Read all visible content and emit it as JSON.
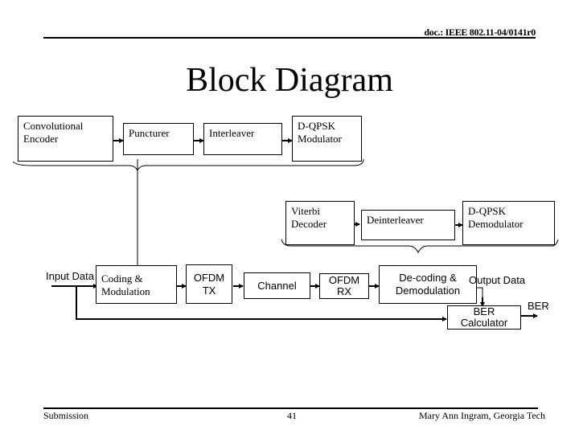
{
  "header": {
    "doc_id": "doc.: IEEE 802.11-04/0141r0",
    "title": "Block Diagram"
  },
  "encoder_chain": {
    "blocks": [
      {
        "label": "Convolutional Encoder"
      },
      {
        "label": "Puncturer"
      },
      {
        "label": "Interleaver"
      },
      {
        "label": "D-QPSK Modulator"
      }
    ]
  },
  "decoder_chain": {
    "blocks": [
      {
        "label": "Viterbi Decoder"
      },
      {
        "label": "Deinterleaver"
      },
      {
        "label": "D-QPSK Demodulator"
      }
    ]
  },
  "system_chain": {
    "input_label": "Input Data",
    "output_label": "Output Data",
    "ber_label": "BER",
    "blocks": [
      {
        "label": "Coding & Modulation"
      },
      {
        "label": "OFDM TX"
      },
      {
        "label": "Channel"
      },
      {
        "label": "OFDM RX"
      },
      {
        "label": "De-coding & Demodulation"
      },
      {
        "label": "BER Calculator"
      }
    ]
  },
  "footer": {
    "left": "Submission",
    "center": "41",
    "right": "Mary Ann Ingram, Georgia Tech"
  }
}
